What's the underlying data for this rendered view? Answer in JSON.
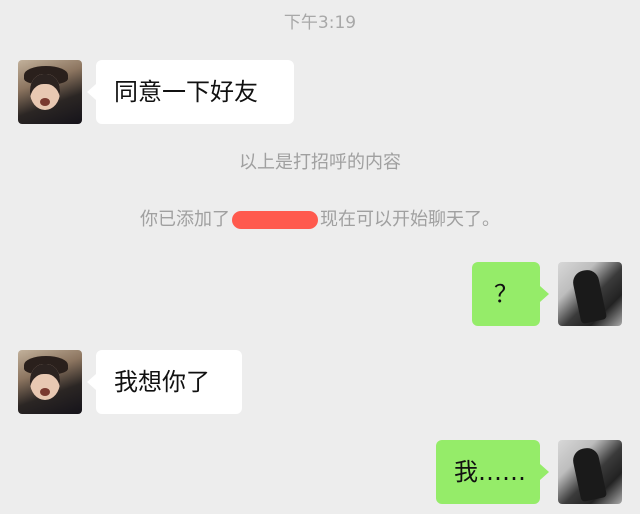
{
  "timestamp": "下午3:19",
  "system": {
    "greeting_notice": "以上是打招呼的内容",
    "added_prefix": "你已添加了",
    "added_suffix": "现在可以开始聊天了。"
  },
  "messages": [
    {
      "side": "left",
      "text": "同意一下好友"
    },
    {
      "side": "right",
      "text": "？"
    },
    {
      "side": "left",
      "text": "我想你了"
    },
    {
      "side": "right",
      "text": "我……"
    }
  ],
  "colors": {
    "background": "#ededed",
    "incoming_bubble": "#ffffff",
    "outgoing_bubble": "#95ec69",
    "redaction": "#ff5a4e"
  }
}
